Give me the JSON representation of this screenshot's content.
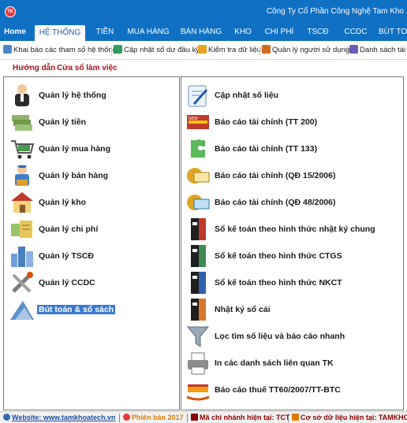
{
  "app": {
    "logo_text": "TK",
    "company": "Công Ty Cổ Phần Công Nghệ Tam Kho"
  },
  "tabs": [
    {
      "label": "Home"
    },
    {
      "label": "HỆ THỐNG"
    },
    {
      "label": "TIỀN"
    },
    {
      "label": "MUA HÀNG"
    },
    {
      "label": "BÁN HÀNG"
    },
    {
      "label": "KHO"
    },
    {
      "label": "CHI PHÍ"
    },
    {
      "label": "TSCĐ"
    },
    {
      "label": "CCDC"
    },
    {
      "label": "BÚT TO"
    }
  ],
  "active_tab": "HỆ THỐNG",
  "toolbar": [
    {
      "label": "Khai báo các tham số hệ thống",
      "icon": "users-settings-icon"
    },
    {
      "label": "Cập nhật số dư đầu kỳ",
      "icon": "arrow-update-icon"
    },
    {
      "label": "Kiểm tra dữ liệu",
      "icon": "check-data-icon"
    },
    {
      "label": "Quản lý người sử dụng",
      "icon": "user-manage-icon"
    },
    {
      "label": "Danh sách tài kh",
      "icon": "list-icon"
    }
  ],
  "subbar": {
    "guide": "Hướng dẫn",
    "window": "Cửa sổ làm việc"
  },
  "left_items": [
    {
      "label": "Quản lý hệ thống",
      "icon": "system-admin-icon"
    },
    {
      "label": "Quản lý tiền",
      "icon": "money-icon"
    },
    {
      "label": "Quản lý mua hàng",
      "icon": "shopping-cart-icon"
    },
    {
      "label": "Quản lý bán hàng",
      "icon": "sales-person-icon"
    },
    {
      "label": "Quản lý kho",
      "icon": "warehouse-icon"
    },
    {
      "label": "Quản lý chi phí",
      "icon": "expense-icon"
    },
    {
      "label": "Quản lý TSCĐ",
      "icon": "buildings-icon"
    },
    {
      "label": "Quản lý CCDC",
      "icon": "tools-icon"
    },
    {
      "label": "Bút toán & sổ sách",
      "icon": "ledger-icon"
    }
  ],
  "right_items": [
    {
      "label": "Cập nhật số liệu",
      "icon": "update-data-icon"
    },
    {
      "label": "Báo cáo tài chính (TT 200)",
      "icon": "report-tt200-icon"
    },
    {
      "label": "Báo cáo tài chính (TT 133)",
      "icon": "puzzle-icon"
    },
    {
      "label": "Báo cáo tài chính (QĐ 15/2006)",
      "icon": "report-qd15-icon"
    },
    {
      "label": "Báo cáo tài chính (QĐ 48/2006)",
      "icon": "report-qd48-icon"
    },
    {
      "label": "Sổ kế toán theo hình thức nhật ký chung",
      "icon": "binder-red-icon"
    },
    {
      "label": "Sổ kế toán theo hình thức CTGS",
      "icon": "binder-green-icon"
    },
    {
      "label": "Sổ kế toán theo hình thức NKCT",
      "icon": "binder-blue-icon"
    },
    {
      "label": "Nhật ký sổ cái",
      "icon": "binder-orange-icon"
    },
    {
      "label": "Lọc tìm số liệu và báo cáo nhanh",
      "icon": "filter-icon"
    },
    {
      "label": "In các danh sách liên quan TK",
      "icon": "printer-icon"
    },
    {
      "label": "Báo cáo thuế TT60/2007/TT-BTC",
      "icon": "tax-report-icon"
    }
  ],
  "status": {
    "website": "Website: www.tamkhoatech.vn",
    "version": "Phiên bản 2017",
    "branch": "Mã chi nhánh hiện tại: TCT",
    "database": "Cơ sở dữ liệu hiện tại: TAMKHOA"
  },
  "colors": {
    "header_blue": "#0f70c4",
    "selection_blue": "#3b79d0",
    "subbar_red": "#a0151b"
  }
}
